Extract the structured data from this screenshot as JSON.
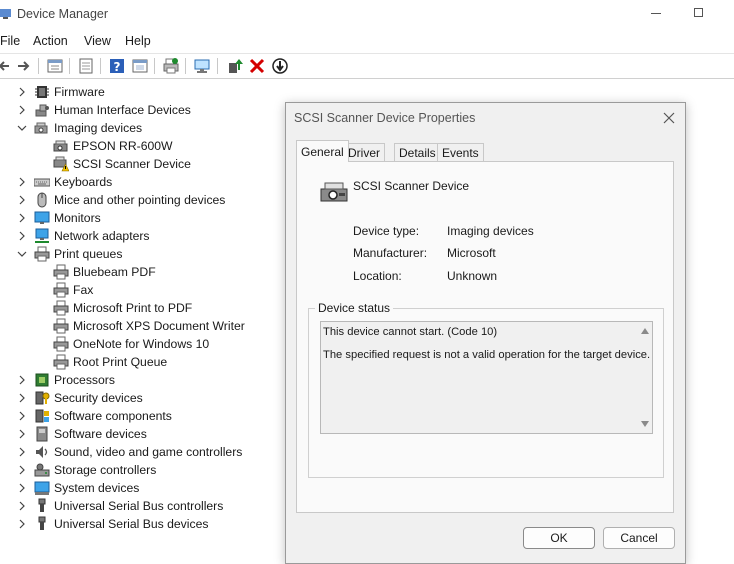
{
  "window": {
    "title": "Device Manager"
  },
  "menu": {
    "file": "File",
    "action": "Action",
    "view": "View",
    "help": "Help"
  },
  "tree": {
    "firmware": "Firmware",
    "hid": "Human Interface Devices",
    "imaging": "Imaging devices",
    "epson": "EPSON RR-600W",
    "scsi": "SCSI Scanner Device",
    "keyboards": "Keyboards",
    "mice": "Mice and other pointing devices",
    "monitors": "Monitors",
    "network": "Network adapters",
    "printq": "Print queues",
    "bluebeam": "Bluebeam PDF",
    "fax": "Fax",
    "mspdf": "Microsoft Print to PDF",
    "xps": "Microsoft XPS Document Writer",
    "onenote": "OneNote for Windows 10",
    "rootq": "Root Print Queue",
    "processors": "Processors",
    "security": "Security devices",
    "swcomp": "Software components",
    "swdev": "Software devices",
    "sound": "Sound, video and game controllers",
    "storage": "Storage controllers",
    "system": "System devices",
    "usbctrl": "Universal Serial Bus controllers",
    "usbdev": "Universal Serial Bus devices"
  },
  "dialog": {
    "title": "SCSI Scanner Device Properties",
    "tabs": {
      "general": "General",
      "driver": "Driver",
      "details": "Details",
      "events": "Events"
    },
    "device_name": "SCSI Scanner Device",
    "type_label": "Device type:",
    "type_value": "Imaging devices",
    "mfr_label": "Manufacturer:",
    "mfr_value": "Microsoft",
    "loc_label": "Location:",
    "loc_value": "Unknown",
    "status_label": "Device status",
    "status_line1": "This device cannot start. (Code 10)",
    "status_line2": "The specified request is not a valid operation for the target device.",
    "ok": "OK",
    "cancel": "Cancel"
  },
  "colors": {
    "accent": "#0067c0",
    "warning": "#f2c200",
    "error": "#d40000",
    "green": "#1e8a2e"
  }
}
